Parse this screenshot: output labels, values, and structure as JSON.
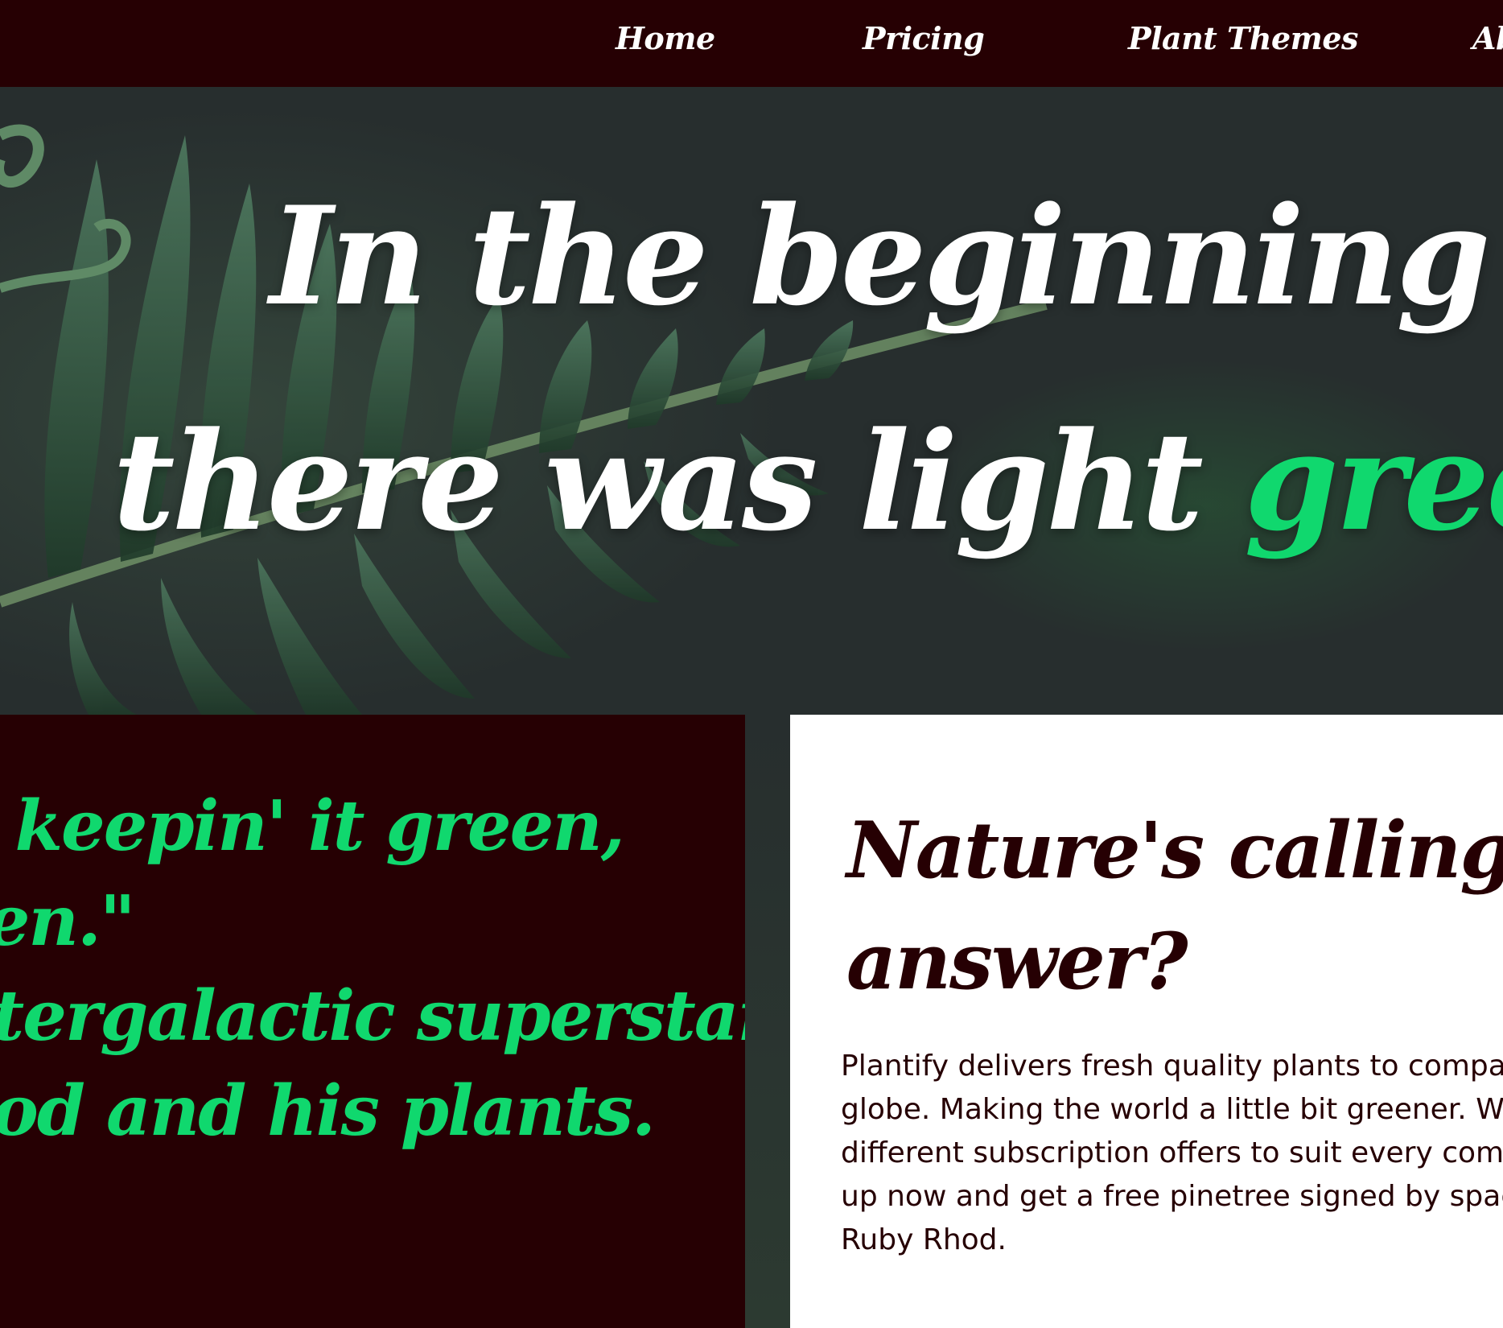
{
  "nav": {
    "items": [
      {
        "label": "Home"
      },
      {
        "label": "Pricing"
      },
      {
        "label": "Plant Themes"
      },
      {
        "label": "Ab"
      }
    ]
  },
  "hero": {
    "line1": "In the beginning",
    "line2_start": "there was light ",
    "line2_accent": "green",
    "line2_end": ".",
    "accent_color": "#10d86e"
  },
  "quote": {
    "lines": [
      "n keepin' it green,",
      "een.\"",
      "ntergalactic superstar",
      "hod and his plants."
    ]
  },
  "info": {
    "title_lines": [
      "Nature's calling. Wha",
      "answer?"
    ],
    "body_lines": [
      "Plantify delivers fresh quality plants to compa",
      "globe. Making the world a little bit greener. W",
      "different subscription offers to suit every com",
      "up now and get a free pinetree signed by spac",
      "Ruby Rhod."
    ]
  },
  "colors": {
    "nav_bg": "#260003",
    "accent_green": "#10d86e",
    "dark_bg": "#272e2e",
    "card_bg": "#ffffff",
    "text_dark": "#260003"
  }
}
